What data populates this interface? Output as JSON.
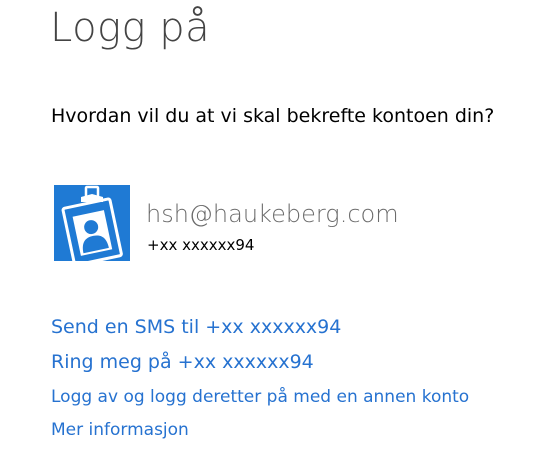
{
  "header": {
    "title": "Logg på"
  },
  "prompt": {
    "question": "Hvordan vil du at vi skal bekrefte kontoen din?"
  },
  "account": {
    "email": "hsh@haukeberg.com",
    "phone": "+xx xxxxxx94",
    "avatar_icon": "id-badge-icon",
    "avatar_color": "#1f7ad4"
  },
  "options": {
    "send_sms": "Send en SMS til +xx xxxxxx94",
    "call_me": "Ring meg på +xx xxxxxx94",
    "sign_out_other": "Logg av og logg deretter på med en annen konto",
    "more_info": "Mer informasjon"
  },
  "colors": {
    "link": "#2672d0",
    "title": "#444444",
    "email": "#6b6b6b"
  }
}
